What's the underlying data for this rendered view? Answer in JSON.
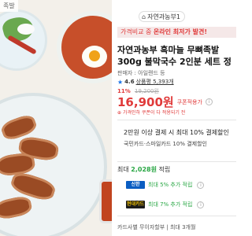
{
  "image_area": {
    "corner_tag": "족발"
  },
  "brand_badge": {
    "label": "자연과농부1"
  },
  "promo": {
    "text1": "가격비교 중 ",
    "text2": "온라인 최저가 발견!"
  },
  "product": {
    "title": "자연과농부 흑마늘 무뼈족발 300g 불막국수 2인분 세트 정",
    "seller": "판매자 : 아일랜드 등",
    "rating": "4.6",
    "reviews": "상품평 5,393개",
    "discount": "11%",
    "original_price": "19,200원",
    "sale_price": "16,900원",
    "coupon_label": "쿠폰적용가",
    "warning": "가격인하 쿠폰이 다 적용되기 전"
  },
  "benefits": {
    "line1": "2만원 이상 결제 시 최대 10% 결제할인",
    "line2": "국민카드·스마일카드 10% 결제할인"
  },
  "points": {
    "prefix": "최대 ",
    "amount": "2,028원",
    "suffix": " 적립"
  },
  "cards": [
    {
      "logo": "신한",
      "text": "최대 5% 추가 적립"
    },
    {
      "logo": "현대카드",
      "text": "최대 7% 추가 적립"
    }
  ],
  "footer": {
    "text": "카드사별 무이자할부 | 최대 3개월"
  },
  "icons": {
    "info": "info-icon",
    "star": "star-icon",
    "house": "house-icon"
  },
  "colors": {
    "accent_red": "#e03a3a",
    "points_green": "#2aa745",
    "rating_blue": "#1a73e8"
  }
}
